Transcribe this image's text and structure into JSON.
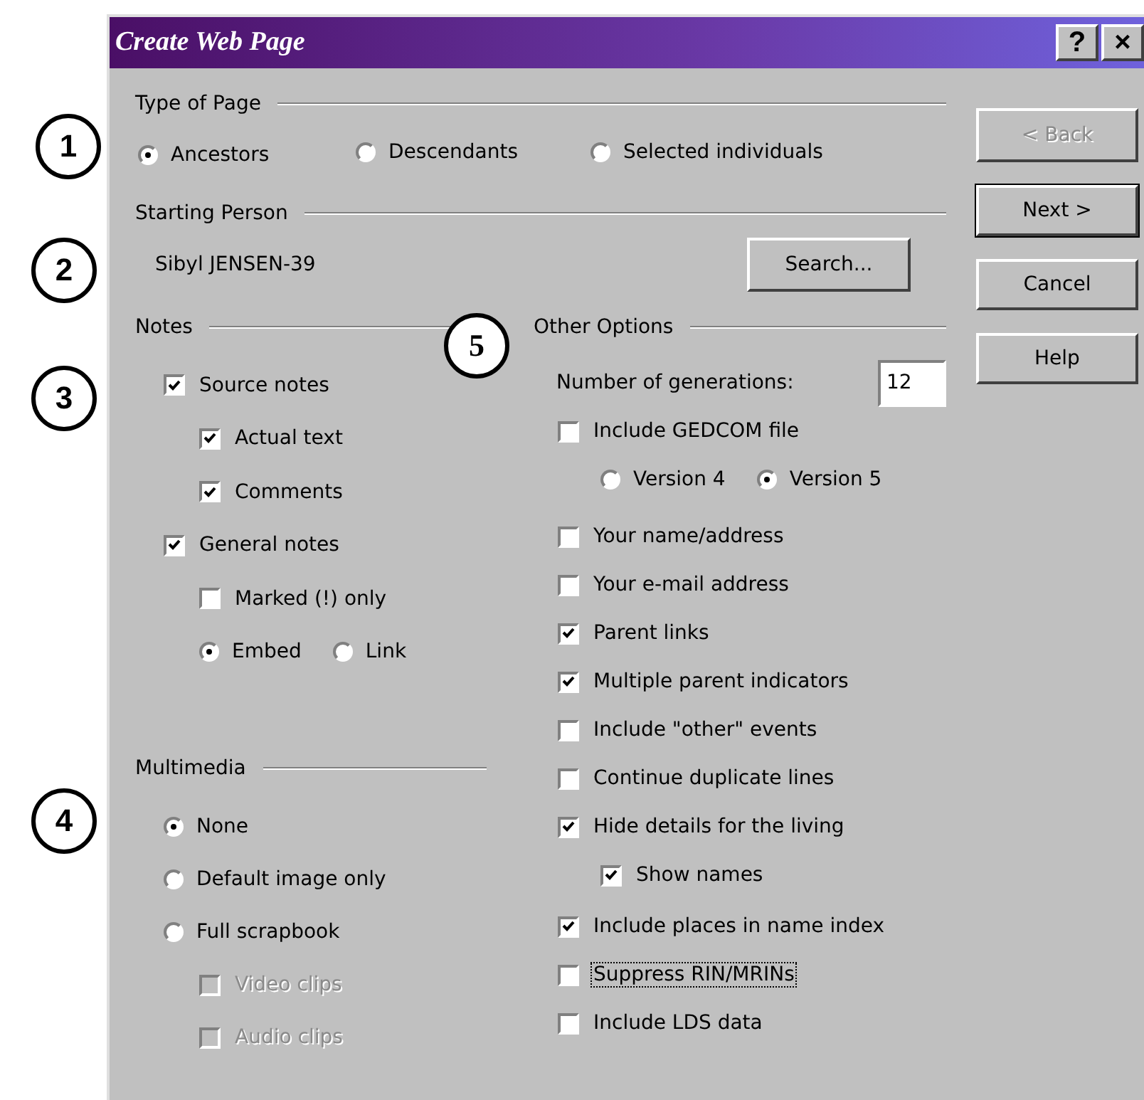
{
  "window": {
    "title": "Create Web Page",
    "title_buttons": [
      "?",
      "×"
    ]
  },
  "callouts": [
    "1",
    "2",
    "3",
    "4",
    "5"
  ],
  "type_of_page": {
    "label": "Type of Page",
    "options": [
      {
        "label": "Ancestors",
        "selected": true
      },
      {
        "label": "Descendants",
        "selected": false
      },
      {
        "label": "Selected individuals",
        "selected": false
      }
    ]
  },
  "starting_person": {
    "label": "Starting Person",
    "value": "Sibyl JENSEN-39",
    "button": "Search..."
  },
  "notes": {
    "label": "Notes",
    "items": [
      {
        "kind": "checkbox",
        "label": "Source notes",
        "checked": true,
        "children": [
          {
            "kind": "checkbox",
            "label": "Actual text",
            "checked": true
          },
          {
            "kind": "checkbox",
            "label": "Comments",
            "checked": true
          }
        ]
      },
      {
        "kind": "checkbox",
        "label": "General notes",
        "checked": true,
        "children": [
          {
            "kind": "checkbox",
            "label": "Marked (!) only",
            "checked": false
          },
          {
            "kind": "radio_group",
            "options": [
              {
                "label": "Embed",
                "selected": true
              },
              {
                "label": "Link",
                "selected": false
              }
            ]
          }
        ]
      }
    ]
  },
  "multimedia": {
    "label": "Multimedia",
    "items": [
      {
        "kind": "radio",
        "label": "None",
        "selected": true
      },
      {
        "kind": "radio",
        "label": "Default image only",
        "selected": false
      },
      {
        "kind": "radio",
        "label": "Full scrapbook",
        "selected": false,
        "children": [
          {
            "kind": "checkbox",
            "label": "Video clips",
            "checked": false,
            "disabled": true
          },
          {
            "kind": "checkbox",
            "label": "Audio clips",
            "checked": false,
            "disabled": true
          }
        ]
      }
    ]
  },
  "other_options": {
    "label": "Other Options",
    "generations": {
      "label": "Number of generations:",
      "value": "12"
    },
    "items": [
      {
        "kind": "checkbox",
        "label": "Include GEDCOM file",
        "checked": false,
        "focused": false,
        "children": [
          {
            "kind": "radio_group",
            "options": [
              {
                "label": "Version 4",
                "selected": false
              },
              {
                "label": "Version 5",
                "selected": true
              }
            ]
          }
        ]
      },
      {
        "kind": "checkbox",
        "label": "Your name/address",
        "checked": false,
        "focused": false
      },
      {
        "kind": "checkbox",
        "label": "Your e-mail address",
        "checked": false,
        "focused": false
      },
      {
        "kind": "checkbox",
        "label": "Parent links",
        "checked": true,
        "focused": false
      },
      {
        "kind": "checkbox",
        "label": "Multiple parent indicators",
        "checked": true,
        "focused": false
      },
      {
        "kind": "checkbox",
        "label": "Include \"other\" events",
        "checked": false,
        "focused": false
      },
      {
        "kind": "checkbox",
        "label": "Continue duplicate lines",
        "checked": false,
        "focused": false
      },
      {
        "kind": "checkbox",
        "label": "Hide details for the living",
        "checked": true,
        "focused": false,
        "children": [
          {
            "kind": "checkbox",
            "label": "Show names",
            "checked": true,
            "focused": false
          }
        ]
      },
      {
        "kind": "checkbox",
        "label": "Include places in name index",
        "checked": true,
        "focused": false
      },
      {
        "kind": "checkbox",
        "label": "Suppress RIN/MRINs",
        "checked": false,
        "focused": true
      },
      {
        "kind": "checkbox",
        "label": "Include LDS data",
        "checked": false,
        "focused": false
      }
    ]
  },
  "buttons": [
    {
      "label": "< Back",
      "disabled": true
    },
    {
      "label": "Next >",
      "disabled": false
    },
    {
      "label": "Cancel",
      "disabled": false
    },
    {
      "label": "Help",
      "disabled": false
    }
  ]
}
